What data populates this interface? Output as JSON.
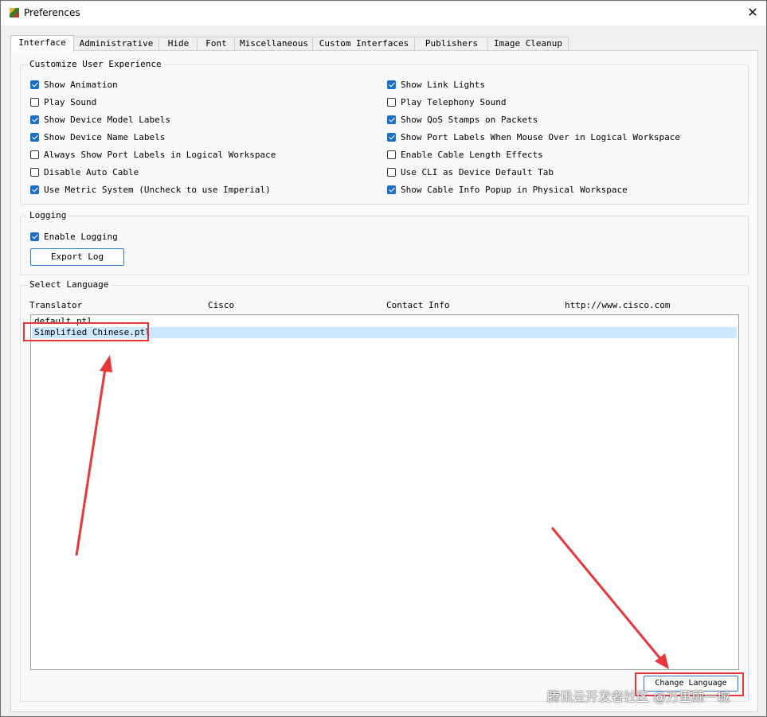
{
  "window": {
    "title": "Preferences"
  },
  "tabs": [
    "Interface",
    "Administrative",
    "Hide",
    "Font",
    "Miscellaneous",
    "Custom Interfaces",
    "Publishers",
    "Image Cleanup"
  ],
  "customize": {
    "title": "Customize User Experience",
    "left": [
      {
        "label": "Show Animation",
        "checked": true
      },
      {
        "label": "Play Sound",
        "checked": false
      },
      {
        "label": "Show Device Model Labels",
        "checked": true
      },
      {
        "label": "Show Device Name Labels",
        "checked": true
      },
      {
        "label": "Always Show Port Labels in Logical Workspace",
        "checked": false
      },
      {
        "label": "Disable Auto Cable",
        "checked": false
      },
      {
        "label": "Use Metric System (Uncheck to use Imperial)",
        "checked": true
      }
    ],
    "right": [
      {
        "label": "Show Link Lights",
        "checked": true
      },
      {
        "label": "Play Telephony Sound",
        "checked": false
      },
      {
        "label": "Show QoS Stamps on Packets",
        "checked": true
      },
      {
        "label": "Show Port Labels When Mouse Over in Logical Workspace",
        "checked": true
      },
      {
        "label": "Enable Cable Length Effects",
        "checked": false
      },
      {
        "label": "Use CLI as Device Default Tab",
        "checked": false
      },
      {
        "label": "Show Cable Info Popup in Physical Workspace",
        "checked": true
      }
    ]
  },
  "logging": {
    "title": "Logging",
    "enable_label": "Enable Logging",
    "enabled": true,
    "export_label": "Export Log"
  },
  "language": {
    "title": "Select Language",
    "translator_label": "Translator",
    "translator": "Cisco",
    "contact_label": "Contact Info",
    "contact": "http://www.cisco.com",
    "items": [
      "default.ptl",
      "Simplified Chinese.ptl"
    ],
    "selected_index": 1,
    "change_label": "Change Language"
  },
  "annotation_color": "#e8363a",
  "watermark": "腾讯云开发者社区 @万里顾一城"
}
